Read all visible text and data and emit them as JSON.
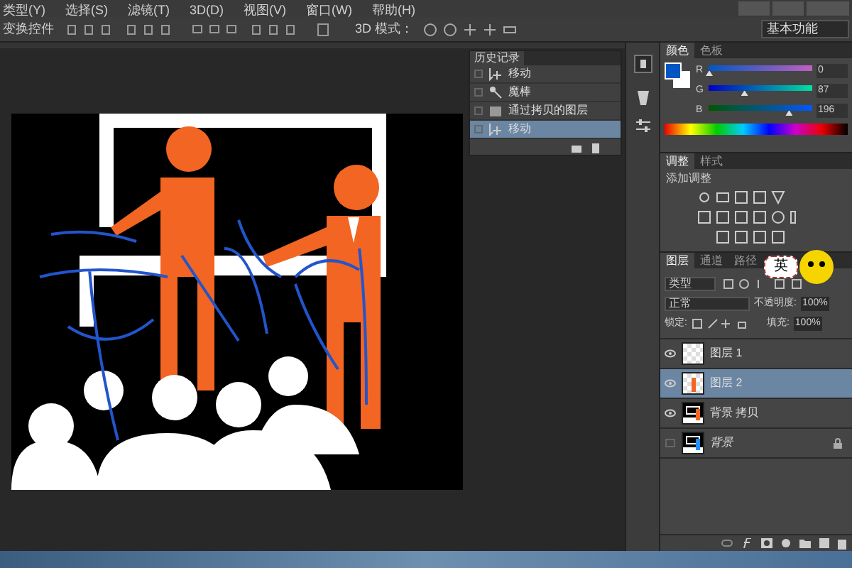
{
  "menu_bar": {
    "items": [
      "类型(Y)",
      "选择(S)",
      "滤镜(T)",
      "3D(D)",
      "视图(V)",
      "窗口(W)",
      "帮助(H)"
    ]
  },
  "options_bar": {
    "label": "变换控件",
    "mode_label": "3D 模式：",
    "workspace": "基本功能"
  },
  "history_panel": {
    "title": "历史记录",
    "items": [
      {
        "label": "移动",
        "kind": "move",
        "selected": false
      },
      {
        "label": "魔棒",
        "kind": "wand",
        "selected": false
      },
      {
        "label": "通过拷贝的图层",
        "kind": "layer",
        "selected": false
      },
      {
        "label": "移动",
        "kind": "move",
        "selected": true
      }
    ]
  },
  "color_panel": {
    "tabs": [
      {
        "label": "颜色",
        "selected": true
      },
      {
        "label": "色板",
        "selected": false
      }
    ],
    "channels": [
      {
        "name": "R",
        "value": "0",
        "level": 0
      },
      {
        "name": "G",
        "value": "87",
        "level": 0.34
      },
      {
        "name": "B",
        "value": "196",
        "level": 0.77
      }
    ]
  },
  "adjustments_panel": {
    "tabs": [
      {
        "label": "调整",
        "selected": true
      },
      {
        "label": "样式",
        "selected": false
      }
    ],
    "heading": "添加调整"
  },
  "layers_panel": {
    "tabs": [
      {
        "label": "图层",
        "selected": true
      },
      {
        "label": "通道",
        "selected": false
      },
      {
        "label": "路径",
        "selected": false
      }
    ],
    "overlay_badge": "英",
    "filter": "类型",
    "blend_mode": "正常",
    "opacity_label": "不透明度:",
    "opacity": "100%",
    "lock_label": "锁定:",
    "fill_label": "填充:",
    "fill": "100%",
    "layers": [
      {
        "name": "图层 1",
        "kind": "transparent",
        "visible": true,
        "selected": false,
        "locked": false
      },
      {
        "name": "图层 2",
        "kind": "figure",
        "visible": true,
        "selected": true,
        "locked": false
      },
      {
        "name": "背景 拷贝",
        "kind": "scene",
        "visible": true,
        "selected": false,
        "locked": false
      },
      {
        "name": "背景",
        "kind": "scene",
        "visible": false,
        "selected": false,
        "locked": true
      }
    ]
  }
}
